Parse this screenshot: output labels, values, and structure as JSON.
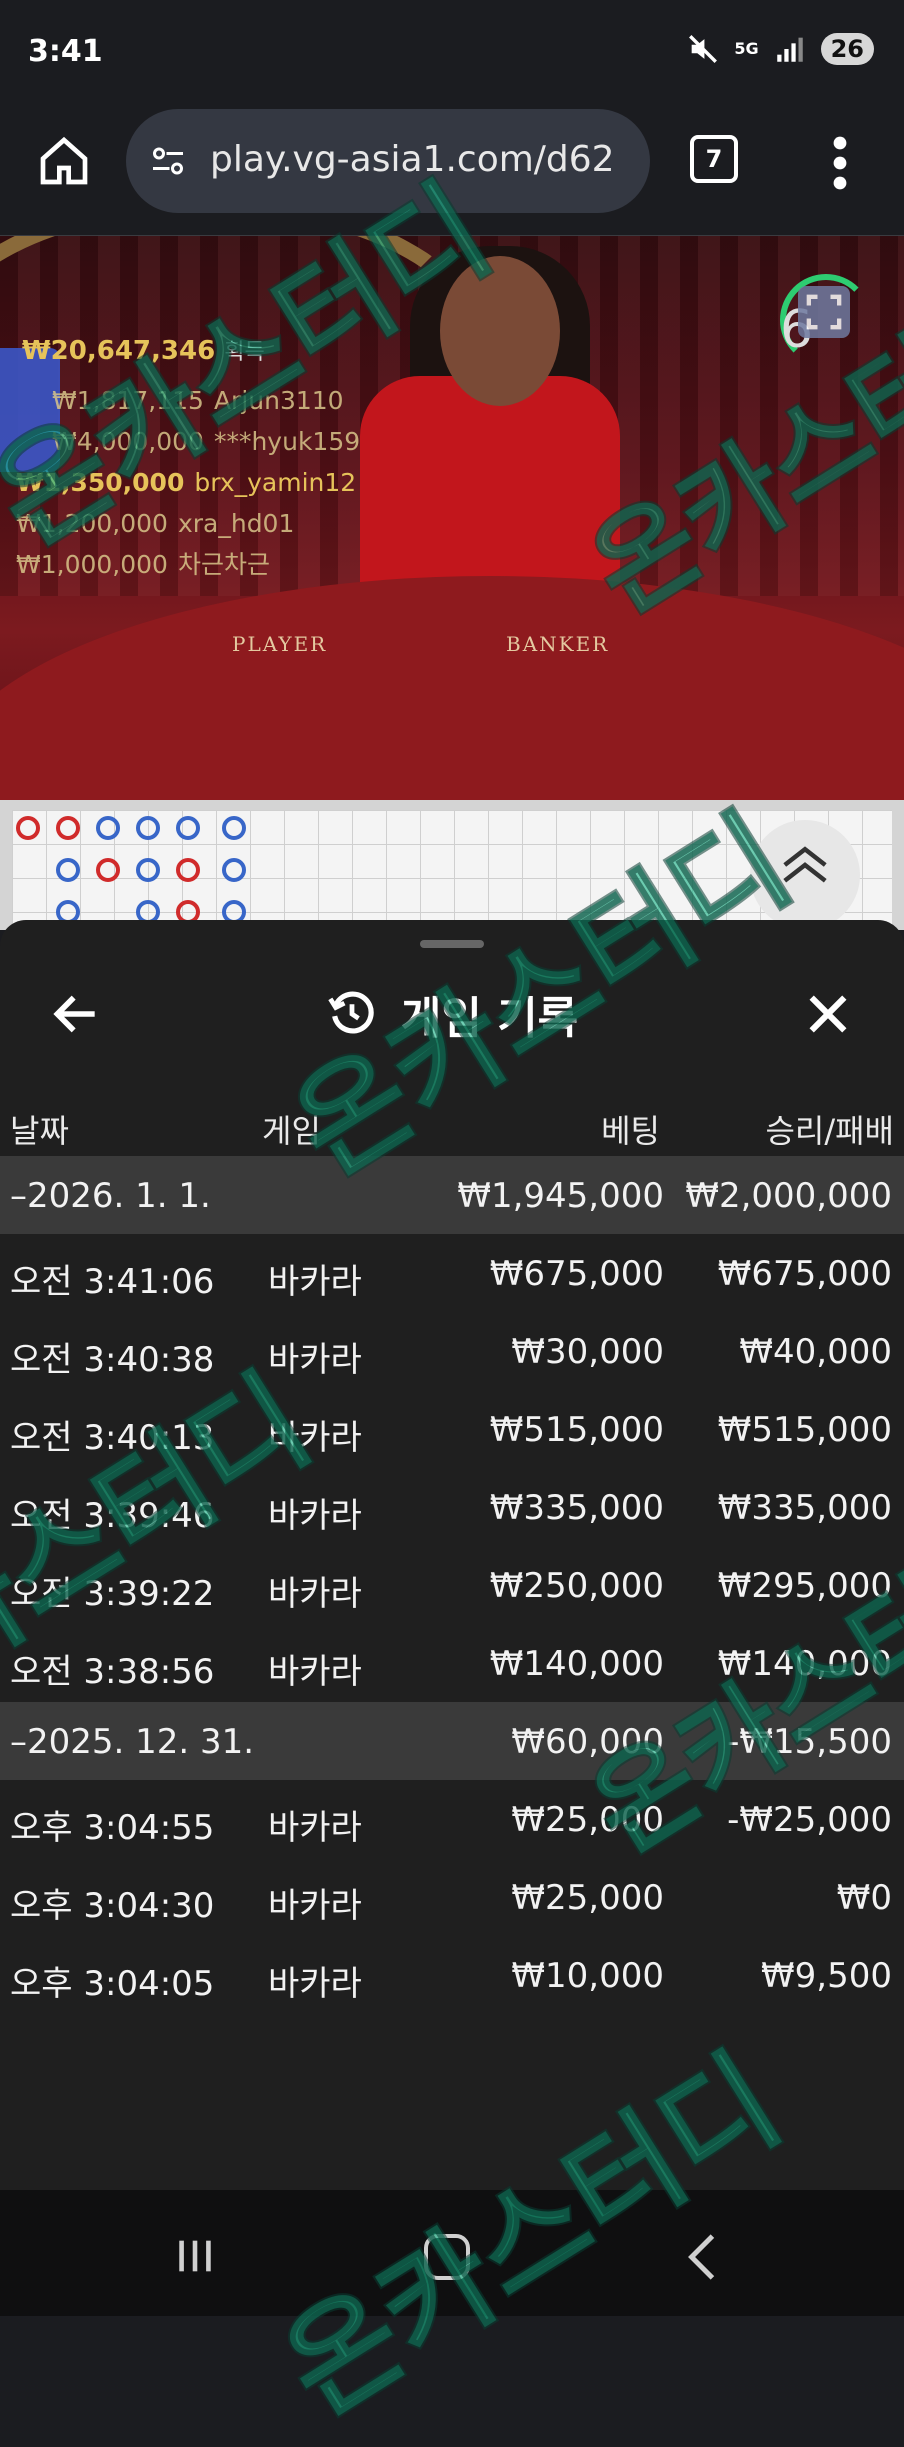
{
  "status_bar": {
    "time": "3:41",
    "network": "5G",
    "battery": "26"
  },
  "browser": {
    "url": "play.vg-asia1.com/d62",
    "tab_count": "7"
  },
  "video": {
    "total_winnings": "₩20,647,346",
    "total_suffix": "획득",
    "winners": [
      {
        "amount": "₩1,817,115",
        "name": "Arjun3110"
      },
      {
        "amount": "₩4,000,000",
        "name": "***hyuk159"
      },
      {
        "amount": "₩1,350,000",
        "name": "brx_yamin12"
      },
      {
        "amount": "₩1,200,000",
        "name": "xra_hd01"
      },
      {
        "amount": "₩1,000,000",
        "name": "차근차근"
      }
    ],
    "table_labels": {
      "player": "PLAYER",
      "banker": "BANKER"
    },
    "countdown": "6"
  },
  "history": {
    "title": "게임 기록",
    "columns": {
      "date": "날짜",
      "game": "게임",
      "bet": "베팅",
      "win_loss": "승리/패배"
    },
    "rows": [
      {
        "type": "group",
        "date": "–2026. 1. 1.",
        "game": "",
        "bet": "₩1,945,000",
        "win": "₩2,000,000"
      },
      {
        "type": "item",
        "date": "오전 3:41:06",
        "game": "바카라",
        "bet": "₩675,000",
        "win": "₩675,000"
      },
      {
        "type": "item",
        "date": "오전 3:40:38",
        "game": "바카라",
        "bet": "₩30,000",
        "win": "₩40,000"
      },
      {
        "type": "item",
        "date": "오전 3:40:13",
        "game": "바카라",
        "bet": "₩515,000",
        "win": "₩515,000"
      },
      {
        "type": "item",
        "date": "오전 3:39:46",
        "game": "바카라",
        "bet": "₩335,000",
        "win": "₩335,000"
      },
      {
        "type": "item",
        "date": "오전 3:39:22",
        "game": "바카라",
        "bet": "₩250,000",
        "win": "₩295,000"
      },
      {
        "type": "item",
        "date": "오전 3:38:56",
        "game": "바카라",
        "bet": "₩140,000",
        "win": "₩140,000"
      },
      {
        "type": "group",
        "date": "–2025. 12. 31.",
        "game": "",
        "bet": "₩60,000",
        "win": "-₩15,500"
      },
      {
        "type": "item",
        "date": "오후 3:04:55",
        "game": "바카라",
        "bet": "₩25,000",
        "win": "-₩25,000"
      },
      {
        "type": "item",
        "date": "오후 3:04:30",
        "game": "바카라",
        "bet": "₩25,000",
        "win": "₩0"
      },
      {
        "type": "item",
        "date": "오후 3:04:05",
        "game": "바카라",
        "bet": "₩10,000",
        "win": "₩9,500"
      }
    ]
  },
  "watermark": {
    "text": "온카스터디"
  },
  "colors": {
    "sheet_bg": "#1f1f1f",
    "group_row_bg": "#3a3a3a",
    "watermark": "#18b286",
    "gold": "#e6c35a"
  }
}
